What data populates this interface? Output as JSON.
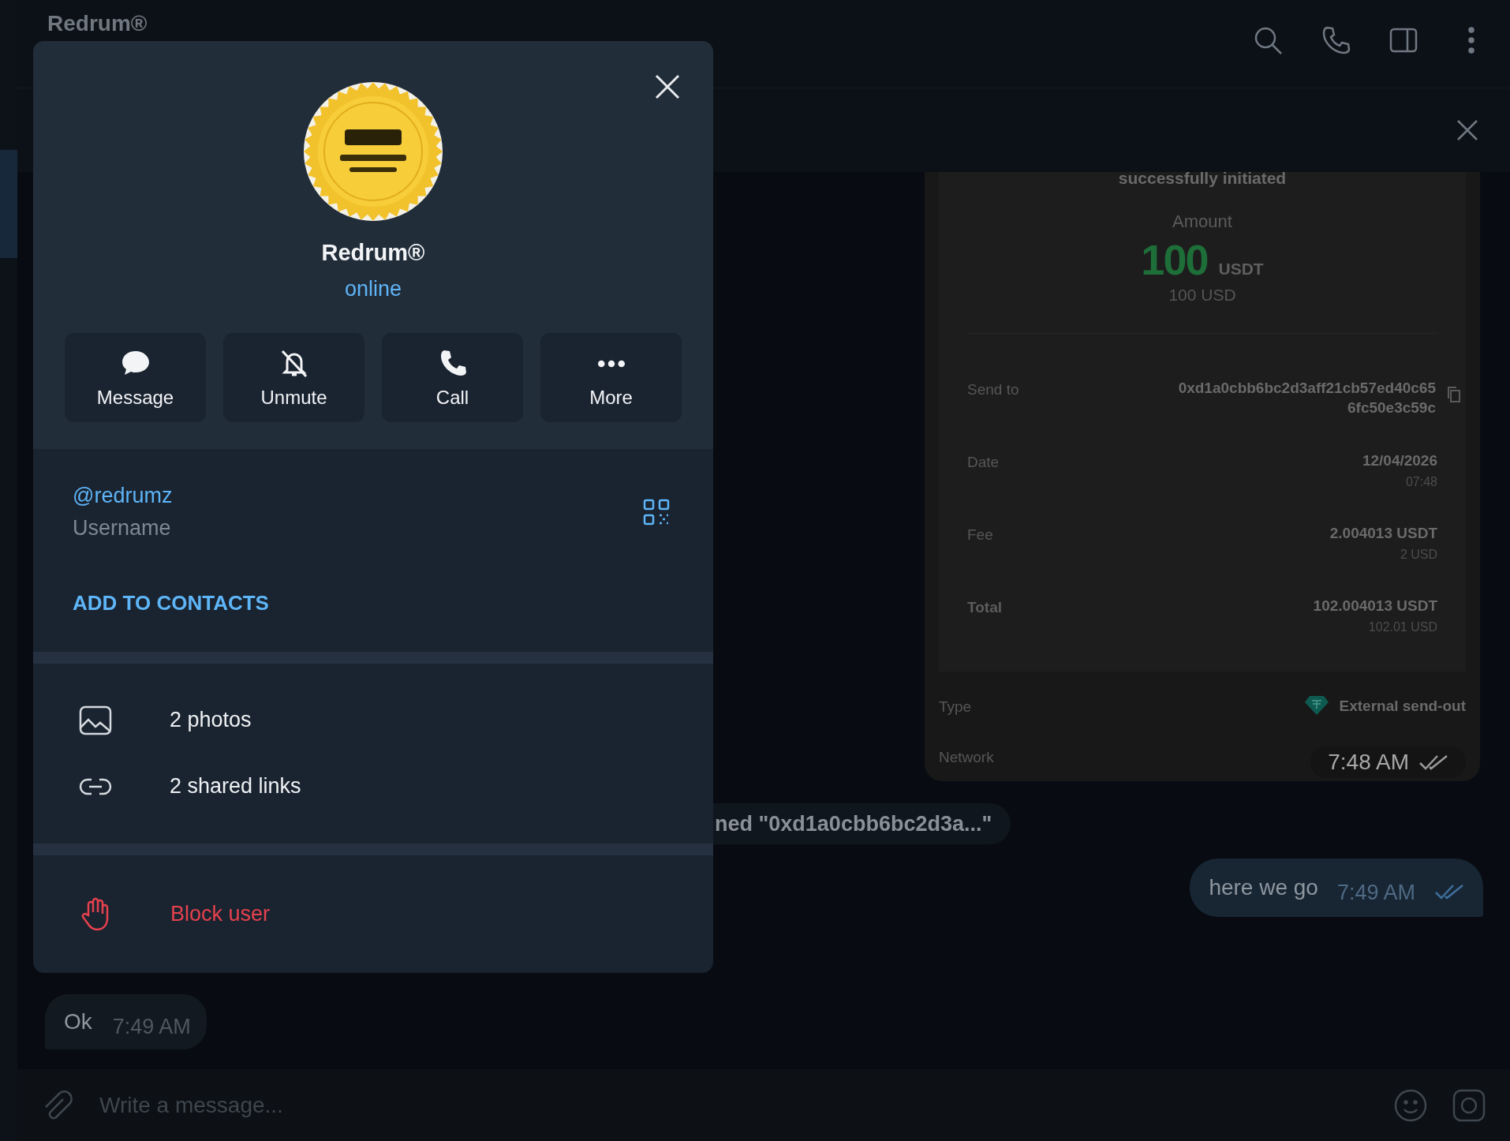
{
  "header": {
    "title": "Redrum®"
  },
  "messages": [
    {
      "kind": "receipt",
      "heading": "successfully initiated",
      "amount_label": "Amount",
      "amount": "100",
      "currency": "USDT",
      "fiat": "100 USD",
      "rows": [
        {
          "label": "Send to",
          "bold": false,
          "value_lines": [
            "0xd1a0cbb6bc2d3aff21cb57ed40c65",
            "6fc50e3c59c"
          ],
          "copyable": true
        },
        {
          "label": "Date",
          "bold": false,
          "value_lines": [
            "12/04/2026"
          ],
          "sub": "07:48",
          "copyable": false
        },
        {
          "label": "Fee",
          "bold": false,
          "value_lines": [
            "2.004013 USDT"
          ],
          "sub": "2 USD",
          "copyable": false
        },
        {
          "label": "Total",
          "bold": true,
          "value_lines": [
            "102.004013 USDT"
          ],
          "sub": "102.01 USD",
          "copyable": false
        }
      ],
      "type_label": "Type",
      "type_value": "External send-out",
      "network_label": "Network",
      "time": "7:48 AM",
      "read": true
    },
    {
      "kind": "service",
      "text": "ned \"0xd1a0cbb6bc2d3a...\""
    },
    {
      "kind": "outgoing",
      "text": "here we go",
      "time": "7:49 AM",
      "read": true
    },
    {
      "kind": "incoming",
      "text": "Ok",
      "time": "7:49 AM"
    }
  ],
  "composer": {
    "placeholder": "Write a message..."
  },
  "profile": {
    "name": "Redrum®",
    "status": "online",
    "actions": [
      {
        "kind": "message",
        "label": "Message"
      },
      {
        "kind": "unmute",
        "label": "Unmute"
      },
      {
        "kind": "call",
        "label": "Call"
      },
      {
        "kind": "more",
        "label": "More"
      }
    ],
    "username": "@redrumz",
    "username_caption": "Username",
    "add_contact": "ADD TO CONTACTS",
    "media": [
      {
        "kind": "photos",
        "label": "2 photos"
      },
      {
        "kind": "links",
        "label": "2 shared links"
      }
    ],
    "block": "Block user"
  }
}
